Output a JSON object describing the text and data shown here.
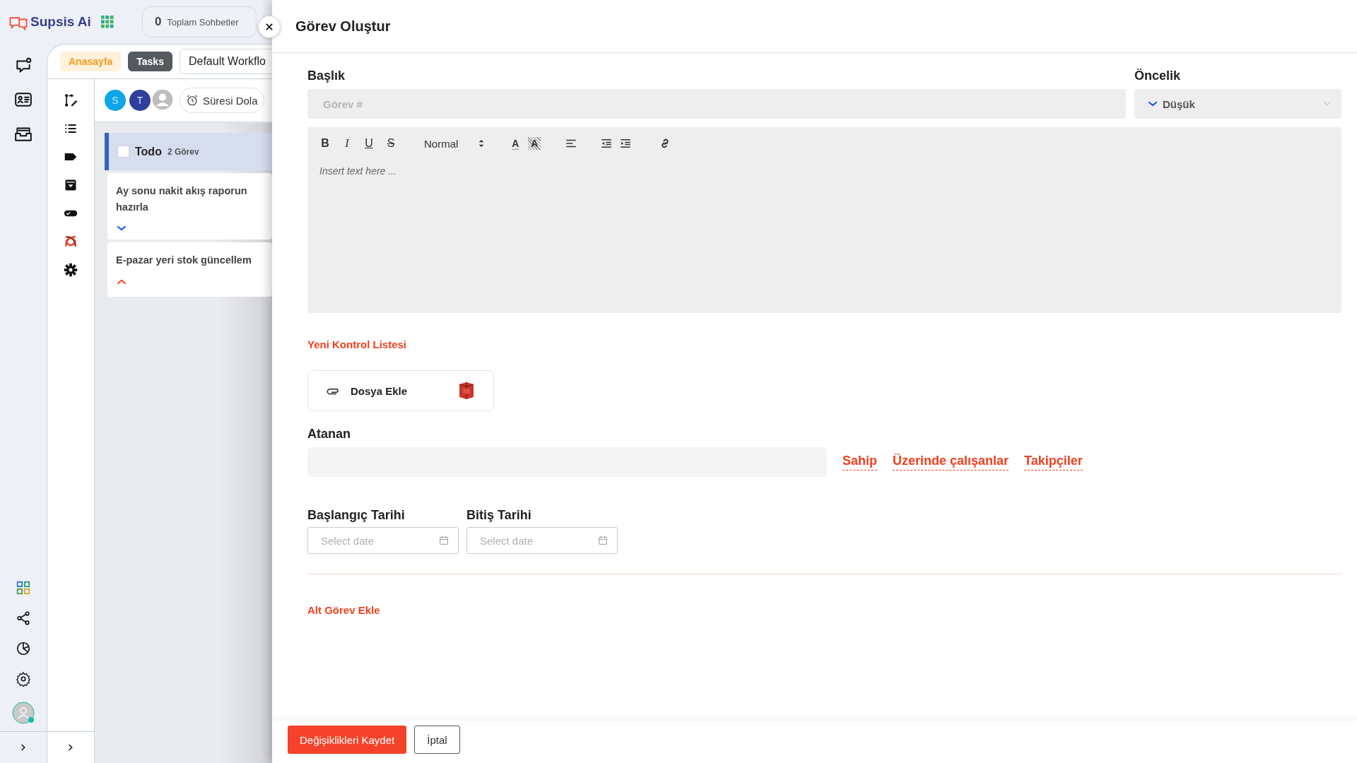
{
  "app": {
    "logo": "Supsis Ai",
    "chat_count": {
      "value": "0",
      "label": "Toplam Sohbetler"
    }
  },
  "tabs": [
    {
      "label": "Anasayfa",
      "kind": "home",
      "selected": false
    },
    {
      "label": "Tasks",
      "kind": "page",
      "selected": true
    },
    {
      "label": "Default Workflo",
      "kind": "page",
      "selected": false
    }
  ],
  "avatars": [
    {
      "kind": "letter",
      "initial": "S",
      "color": "#0ea5e9"
    },
    {
      "kind": "letter",
      "initial": "T",
      "color": "#2f3f9e"
    },
    {
      "kind": "silhouette"
    }
  ],
  "filter": {
    "label": "Süresi Dola"
  },
  "column": {
    "title": "Todo",
    "count": "2 Görev",
    "checked": false,
    "cards": [
      {
        "title": "Ay sonu nakit akış raporun hazırla",
        "high_priority": false
      },
      {
        "title": "E-pazar yeri stok güncellem",
        "high_priority": true
      }
    ]
  },
  "drawer": {
    "title": "Görev Oluştur",
    "title_field": {
      "label": "Başlık",
      "placeholder": "Görev #"
    },
    "priority": {
      "label": "Öncelik",
      "value": "Düşük",
      "high_priority": false
    },
    "editor": {
      "format_buttons": [
        {
          "glyph": "B",
          "kind": "bold"
        },
        {
          "glyph": "I",
          "kind": "italic"
        },
        {
          "glyph": "U",
          "kind": "underline"
        },
        {
          "glyph": "S",
          "kind": "strike"
        }
      ],
      "style": "Normal",
      "color_buttons": [
        {
          "glyph": "A",
          "kind": "color"
        },
        {
          "glyph": "A",
          "kind": "background"
        }
      ],
      "placeholder": "Insert text here ..."
    },
    "checklist_link": "Yeni Kontrol Listesi",
    "attach": {
      "label": "Dosya Ekle"
    },
    "assignee": {
      "label": "Atanan",
      "roles": [
        {
          "label": "Sahip"
        },
        {
          "label": "Üzerinde çalışanlar"
        },
        {
          "label": "Takipçiler"
        }
      ]
    },
    "dates": [
      {
        "label": "Başlangıç Tarihi",
        "placeholder": "Select date"
      },
      {
        "label": "Bitiş Tarihi",
        "placeholder": "Select date"
      }
    ],
    "subtask_link": "Alt Görev Ekle",
    "buttons": [
      {
        "label": "Değişiklikleri Kaydet",
        "kind": "primary"
      },
      {
        "label": "İptal",
        "kind": "secondary"
      }
    ]
  }
}
